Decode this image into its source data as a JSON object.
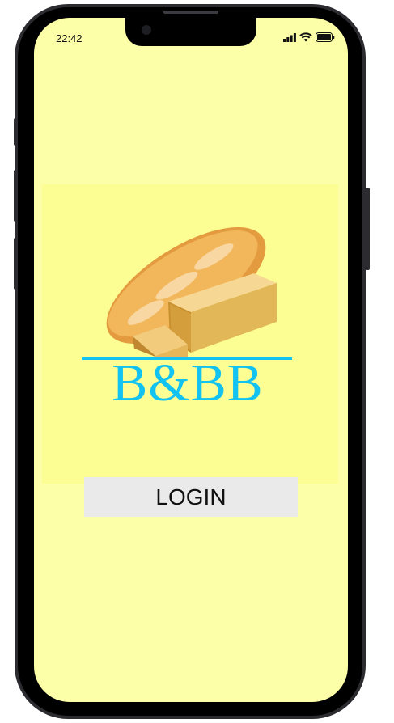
{
  "status_bar": {
    "time": "22:42",
    "icons": [
      "signal-icon",
      "wifi-icon",
      "battery-icon"
    ]
  },
  "logo": {
    "brand_text": "B&BB",
    "image": "bread-loaves-icon"
  },
  "login_button": {
    "label": "LOGIN"
  },
  "colors": {
    "screen_background": "#fcfea8",
    "logo_panel": "#fcfd92",
    "brand_accent": "#12c2f0",
    "button_background": "#eaeaea"
  }
}
